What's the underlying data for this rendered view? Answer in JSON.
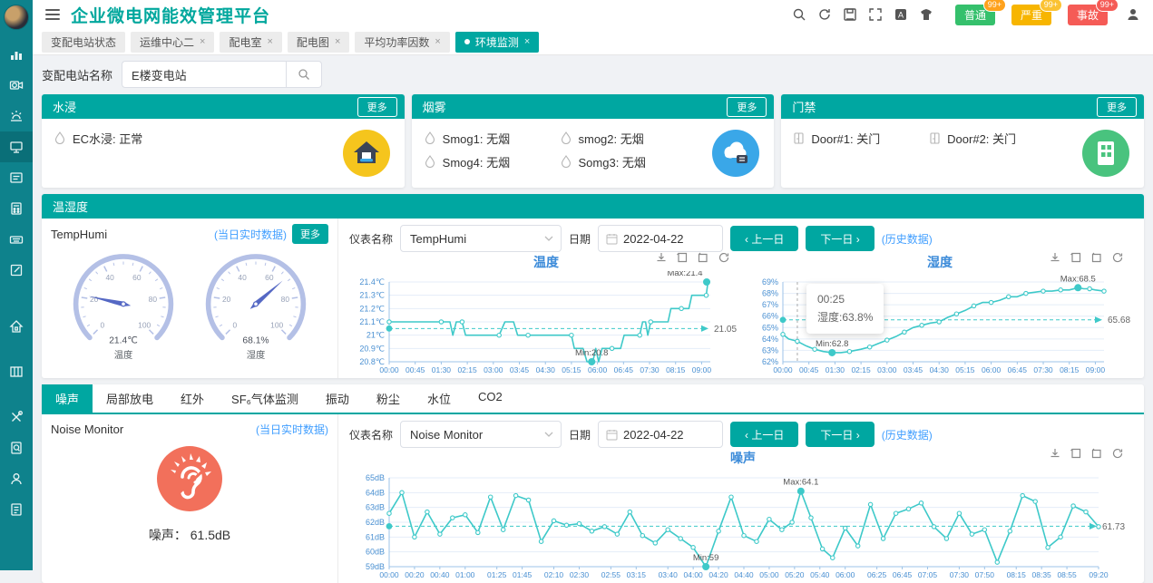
{
  "app": {
    "title": "企业微电网能效管理平台"
  },
  "alarms": [
    {
      "label": "普通",
      "bg": "#35c06c",
      "count": "99+",
      "count_bg": "#ffa21c"
    },
    {
      "label": "严重",
      "bg": "#f7b500",
      "count": "99+",
      "count_bg": "#fbc233"
    },
    {
      "label": "事故",
      "bg": "#f55b56",
      "count": "99+",
      "count_bg": "#f55b56"
    }
  ],
  "nav_tabs": [
    {
      "label": "变配电站状态",
      "closable": false,
      "active": false
    },
    {
      "label": "运维中心二",
      "closable": true,
      "active": false
    },
    {
      "label": "配电室",
      "closable": true,
      "active": false
    },
    {
      "label": "配电图",
      "closable": true,
      "active": false
    },
    {
      "label": "平均功率因数",
      "closable": true,
      "active": false
    },
    {
      "label": "环境监测",
      "closable": true,
      "active": true
    }
  ],
  "sidebar_icons": [
    "bar-chart-icon",
    "camera-icon",
    "alarm-beacon-icon",
    "device-monitor-icon",
    "message-doc-icon",
    "calculator-icon",
    "keyboard-icon",
    "edit-note-icon",
    "home-icon",
    "grid-panel-icon",
    "tools-icon",
    "audit-search-icon",
    "user-icon",
    "report-doc-icon"
  ],
  "sidebar_active_index": 3,
  "header_icons": [
    "search-icon",
    "refresh-icon",
    "save-icon",
    "fullscreen-icon",
    "font-size-icon",
    "theme-icon",
    "user-icon"
  ],
  "search": {
    "label": "变配电站名称",
    "value": "E楼变电站"
  },
  "water": {
    "title": "水浸",
    "more": "更多",
    "items": [
      "EC水浸: 正常"
    ]
  },
  "smoke": {
    "title": "烟雾",
    "more": "更多",
    "items": [
      "Smog1: 无烟",
      "smog2: 无烟",
      "Smog4: 无烟",
      "Somg3: 无烟"
    ]
  },
  "door": {
    "title": "门禁",
    "more": "更多",
    "items": [
      "Door#1: 关门",
      "Door#2: 关门"
    ]
  },
  "temphumi": {
    "panel_title": "温湿度",
    "device": "TempHumi",
    "realtime": "(当日实时数据)",
    "more": "更多",
    "gauges": [
      {
        "name": "温度",
        "value": 21.4,
        "display": "21.4℃"
      },
      {
        "name": "湿度",
        "value": 68.1,
        "display": "68.1%"
      }
    ],
    "controls": {
      "meter_label": "仪表名称",
      "meter_value": "TempHumi",
      "date_label": "日期",
      "date_value": "2022-04-22",
      "prev": "‹  上一日",
      "next": "下一日  ›",
      "history": "(历史数据)"
    }
  },
  "env": {
    "tabs": [
      "噪声",
      "局部放电",
      "红外",
      "SF₆气体监测",
      "振动",
      "粉尘",
      "水位",
      "CO2"
    ],
    "active_index": 0,
    "noise": {
      "device": "Noise Monitor",
      "realtime": "(当日实时数据)",
      "reading": "噪声： 61.5dB",
      "controls": {
        "meter_label": "仪表名称",
        "meter_value": "Noise Monitor",
        "date_label": "日期",
        "date_value": "2022-04-22",
        "prev": "‹  上一日",
        "next": "下一日  ›",
        "history": "(历史数据)"
      }
    }
  },
  "chart_data": [
    {
      "id": "chart-temp",
      "type": "line",
      "title": "温度",
      "unit": "℃",
      "ylim": [
        20.8,
        21.4
      ],
      "ylabels": [
        "20.8℃",
        "20.9℃",
        "21℃",
        "21.1℃",
        "21.2℃",
        "21.3℃",
        "21.4℃"
      ],
      "xmax": 555,
      "x_ticks": [
        [
          0,
          "00:00"
        ],
        [
          45,
          "00:45"
        ],
        [
          90,
          "01:30"
        ],
        [
          135,
          "02:15"
        ],
        [
          180,
          "03:00"
        ],
        [
          225,
          "03:45"
        ],
        [
          270,
          "04:30"
        ],
        [
          315,
          "05:15"
        ],
        [
          360,
          "06:00"
        ],
        [
          405,
          "06:45"
        ],
        [
          450,
          "07:30"
        ],
        [
          495,
          "08:15"
        ],
        [
          540,
          "09:00"
        ]
      ],
      "points": [
        [
          0,
          21.1
        ],
        [
          20,
          21.1
        ],
        [
          45,
          21.1
        ],
        [
          70,
          21.1
        ],
        [
          90,
          21.1
        ],
        [
          105,
          21.1
        ],
        [
          110,
          21.0
        ],
        [
          116,
          21.1
        ],
        [
          126,
          21.1
        ],
        [
          132,
          21.0
        ],
        [
          150,
          21.0
        ],
        [
          170,
          21.0
        ],
        [
          190,
          21.0
        ],
        [
          200,
          21.1
        ],
        [
          215,
          21.1
        ],
        [
          222,
          21.0
        ],
        [
          240,
          21.0
        ],
        [
          260,
          21.0
        ],
        [
          280,
          21.0
        ],
        [
          300,
          21.0
        ],
        [
          315,
          21.0
        ],
        [
          320,
          20.9
        ],
        [
          335,
          20.9
        ],
        [
          342,
          20.8
        ],
        [
          352,
          20.8
        ],
        [
          357,
          20.9
        ],
        [
          362,
          20.8
        ],
        [
          368,
          20.9
        ],
        [
          385,
          20.9
        ],
        [
          400,
          20.9
        ],
        [
          406,
          21.0
        ],
        [
          420,
          21.0
        ],
        [
          433,
          21.0
        ],
        [
          438,
          21.1
        ],
        [
          443,
          21.1
        ],
        [
          447,
          21.0
        ],
        [
          452,
          21.1
        ],
        [
          468,
          21.1
        ],
        [
          482,
          21.1
        ],
        [
          487,
          21.2
        ],
        [
          505,
          21.2
        ],
        [
          518,
          21.2
        ],
        [
          523,
          21.3
        ],
        [
          540,
          21.3
        ],
        [
          548,
          21.3
        ],
        [
          551,
          21.4
        ],
        [
          555,
          21.4
        ]
      ],
      "avg": 21.05,
      "avg_label": "21.05",
      "max": {
        "t": 555,
        "v": 21.4,
        "label": "Max:21.4"
      },
      "min": {
        "t": 350,
        "v": 20.8,
        "label": "Min:20.8"
      },
      "marker_every": 4
    },
    {
      "id": "chart-humi",
      "type": "line",
      "title": "湿度",
      "unit": "%",
      "ylim": [
        62,
        69
      ],
      "ylabels": [
        "62%",
        "63%",
        "64%",
        "65%",
        "66%",
        "67%",
        "68%",
        "69%"
      ],
      "xmax": 555,
      "x_ticks": [
        [
          0,
          "00:00"
        ],
        [
          45,
          "00:45"
        ],
        [
          90,
          "01:30"
        ],
        [
          135,
          "02:15"
        ],
        [
          180,
          "03:00"
        ],
        [
          225,
          "03:45"
        ],
        [
          270,
          "04:30"
        ],
        [
          315,
          "05:15"
        ],
        [
          360,
          "06:00"
        ],
        [
          405,
          "06:45"
        ],
        [
          450,
          "07:30"
        ],
        [
          495,
          "08:15"
        ],
        [
          540,
          "09:00"
        ]
      ],
      "points": [
        [
          0,
          64.4
        ],
        [
          10,
          64.0
        ],
        [
          25,
          63.8
        ],
        [
          40,
          63.4
        ],
        [
          55,
          63.1
        ],
        [
          70,
          62.9
        ],
        [
          85,
          62.8
        ],
        [
          100,
          62.8
        ],
        [
          115,
          62.9
        ],
        [
          135,
          63.1
        ],
        [
          150,
          63.3
        ],
        [
          165,
          63.6
        ],
        [
          180,
          63.9
        ],
        [
          195,
          64.2
        ],
        [
          210,
          64.6
        ],
        [
          225,
          65.0
        ],
        [
          240,
          65.2
        ],
        [
          255,
          65.4
        ],
        [
          270,
          65.5
        ],
        [
          285,
          65.9
        ],
        [
          300,
          66.2
        ],
        [
          315,
          66.5
        ],
        [
          330,
          66.9
        ],
        [
          345,
          67.2
        ],
        [
          360,
          67.2
        ],
        [
          375,
          67.4
        ],
        [
          390,
          67.7
        ],
        [
          405,
          67.7
        ],
        [
          420,
          68.0
        ],
        [
          435,
          68.1
        ],
        [
          450,
          68.2
        ],
        [
          465,
          68.2
        ],
        [
          480,
          68.3
        ],
        [
          495,
          68.3
        ],
        [
          510,
          68.5
        ],
        [
          520,
          68.4
        ],
        [
          530,
          68.4
        ],
        [
          540,
          68.3
        ],
        [
          555,
          68.2
        ]
      ],
      "avg": 65.68,
      "avg_label": "65.68",
      "max": {
        "t": 510,
        "v": 68.5,
        "label": "Max:68.5"
      },
      "min": {
        "t": 85,
        "v": 62.8,
        "label": "Min:62.8"
      },
      "marker_every": 2,
      "tooltip": {
        "t": 25,
        "lines": [
          "00:25",
          "湿度:63.8%"
        ]
      }
    },
    {
      "id": "chart-noise",
      "type": "line",
      "title": "噪声",
      "unit": "dB",
      "ylim": [
        59,
        65
      ],
      "ylabels": [
        "59dB",
        "60dB",
        "61dB",
        "62dB",
        "63dB",
        "64dB",
        "65dB"
      ],
      "xmax": 560,
      "x_ticks": [
        [
          0,
          "00:00"
        ],
        [
          20,
          "00:20"
        ],
        [
          40,
          "00:40"
        ],
        [
          60,
          "01:00"
        ],
        [
          85,
          "01:25"
        ],
        [
          105,
          "01:45"
        ],
        [
          130,
          "02:10"
        ],
        [
          150,
          "02:30"
        ],
        [
          175,
          "02:55"
        ],
        [
          195,
          "03:15"
        ],
        [
          220,
          "03:40"
        ],
        [
          240,
          "04:00"
        ],
        [
          260,
          "04:20"
        ],
        [
          280,
          "04:40"
        ],
        [
          300,
          "05:00"
        ],
        [
          320,
          "05:20"
        ],
        [
          340,
          "05:40"
        ],
        [
          360,
          "06:00"
        ],
        [
          385,
          "06:25"
        ],
        [
          405,
          "06:45"
        ],
        [
          425,
          "07:05"
        ],
        [
          450,
          "07:30"
        ],
        [
          470,
          "07:50"
        ],
        [
          495,
          "08:15"
        ],
        [
          515,
          "08:35"
        ],
        [
          535,
          "08:55"
        ],
        [
          560,
          "09:20"
        ]
      ],
      "points": [
        [
          0,
          62.6
        ],
        [
          10,
          64.0
        ],
        [
          20,
          61.0
        ],
        [
          30,
          62.7
        ],
        [
          40,
          61.2
        ],
        [
          50,
          62.3
        ],
        [
          60,
          62.5
        ],
        [
          70,
          61.3
        ],
        [
          80,
          63.7
        ],
        [
          90,
          61.5
        ],
        [
          100,
          63.8
        ],
        [
          110,
          63.5
        ],
        [
          120,
          60.7
        ],
        [
          130,
          62.1
        ],
        [
          140,
          61.8
        ],
        [
          150,
          61.9
        ],
        [
          160,
          61.4
        ],
        [
          170,
          61.7
        ],
        [
          180,
          61.2
        ],
        [
          190,
          62.7
        ],
        [
          200,
          61.1
        ],
        [
          210,
          60.6
        ],
        [
          220,
          61.5
        ],
        [
          230,
          60.9
        ],
        [
          240,
          60.3
        ],
        [
          250,
          59.0
        ],
        [
          260,
          61.4
        ],
        [
          270,
          63.7
        ],
        [
          280,
          61.1
        ],
        [
          290,
          60.7
        ],
        [
          300,
          62.2
        ],
        [
          310,
          61.5
        ],
        [
          318,
          62.0
        ],
        [
          325,
          64.1
        ],
        [
          333,
          62.3
        ],
        [
          342,
          60.2
        ],
        [
          350,
          59.6
        ],
        [
          360,
          61.6
        ],
        [
          370,
          60.4
        ],
        [
          380,
          63.2
        ],
        [
          390,
          60.9
        ],
        [
          400,
          62.6
        ],
        [
          410,
          62.9
        ],
        [
          420,
          63.3
        ],
        [
          430,
          61.7
        ],
        [
          440,
          60.9
        ],
        [
          450,
          62.6
        ],
        [
          460,
          61.2
        ],
        [
          470,
          61.5
        ],
        [
          480,
          59.3
        ],
        [
          490,
          61.4
        ],
        [
          500,
          63.8
        ],
        [
          510,
          63.4
        ],
        [
          520,
          60.3
        ],
        [
          530,
          61.0
        ],
        [
          540,
          63.1
        ],
        [
          550,
          62.7
        ],
        [
          560,
          61.7
        ]
      ],
      "avg": 61.73,
      "avg_label": "61.73",
      "max": {
        "t": 325,
        "v": 64.1,
        "label": "Max:64.1"
      },
      "min": {
        "t": 250,
        "v": 59.0,
        "label": "Min:59"
      },
      "marker_every": 1
    }
  ],
  "toolbox_icons": [
    "download-icon",
    "datazoom-icon",
    "restore-icon",
    "refresh-icon"
  ],
  "colors": {
    "teal": "#00a7a1",
    "sidebar": "#0e828c",
    "line": "#3ec9c9",
    "axis_text": "#4a90d2",
    "water_icon": "#f5c51d",
    "smoke_icon": "#3aa7e8",
    "door_icon": "#49c37e",
    "noise_icon": "#f2705b"
  }
}
